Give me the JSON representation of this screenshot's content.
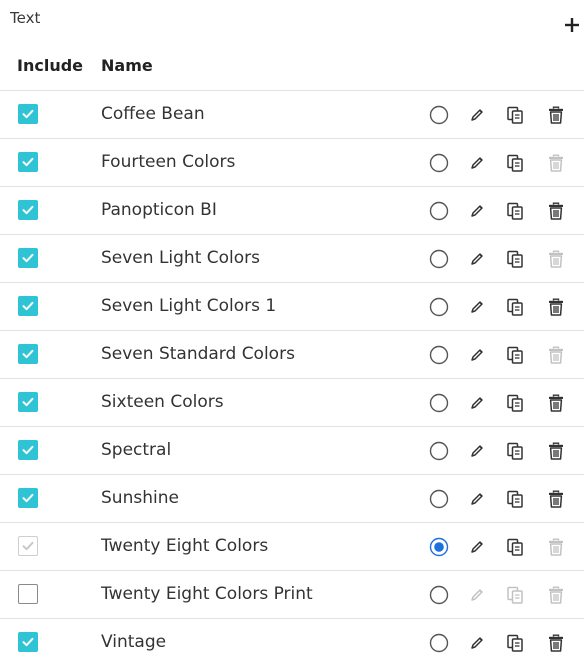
{
  "panel": {
    "section_label": "Text",
    "add_icon": "plus-icon"
  },
  "columns": {
    "include": "Include",
    "name": "Name"
  },
  "colors": {
    "checkbox_accent": "#2ec4d6",
    "radio_selected": "#1e6fe0",
    "icon_enabled": "#333333",
    "icon_disabled": "#c2c2c2"
  },
  "rows": [
    {
      "name": "Coffee Bean",
      "include": "checked",
      "selected": false,
      "edit_enabled": true,
      "duplicate_enabled": true,
      "delete_enabled": true
    },
    {
      "name": "Fourteen Colors",
      "include": "checked",
      "selected": false,
      "edit_enabled": true,
      "duplicate_enabled": true,
      "delete_enabled": false
    },
    {
      "name": "Panopticon BI",
      "include": "checked",
      "selected": false,
      "edit_enabled": true,
      "duplicate_enabled": true,
      "delete_enabled": true
    },
    {
      "name": "Seven Light Colors",
      "include": "checked",
      "selected": false,
      "edit_enabled": true,
      "duplicate_enabled": true,
      "delete_enabled": false
    },
    {
      "name": "Seven Light Colors 1",
      "include": "checked",
      "selected": false,
      "edit_enabled": true,
      "duplicate_enabled": true,
      "delete_enabled": true
    },
    {
      "name": "Seven Standard Colors",
      "include": "checked",
      "selected": false,
      "edit_enabled": true,
      "duplicate_enabled": true,
      "delete_enabled": false
    },
    {
      "name": "Sixteen Colors",
      "include": "checked",
      "selected": false,
      "edit_enabled": true,
      "duplicate_enabled": true,
      "delete_enabled": true
    },
    {
      "name": "Spectral",
      "include": "checked",
      "selected": false,
      "edit_enabled": true,
      "duplicate_enabled": true,
      "delete_enabled": true
    },
    {
      "name": "Sunshine",
      "include": "checked",
      "selected": false,
      "edit_enabled": true,
      "duplicate_enabled": true,
      "delete_enabled": true
    },
    {
      "name": "Twenty Eight Colors",
      "include": "checked-disabled",
      "selected": true,
      "edit_enabled": true,
      "duplicate_enabled": true,
      "delete_enabled": false
    },
    {
      "name": "Twenty Eight Colors Print",
      "include": "unchecked",
      "selected": false,
      "edit_enabled": false,
      "duplicate_enabled": false,
      "delete_enabled": false
    },
    {
      "name": "Vintage",
      "include": "checked",
      "selected": false,
      "edit_enabled": true,
      "duplicate_enabled": true,
      "delete_enabled": true
    }
  ]
}
